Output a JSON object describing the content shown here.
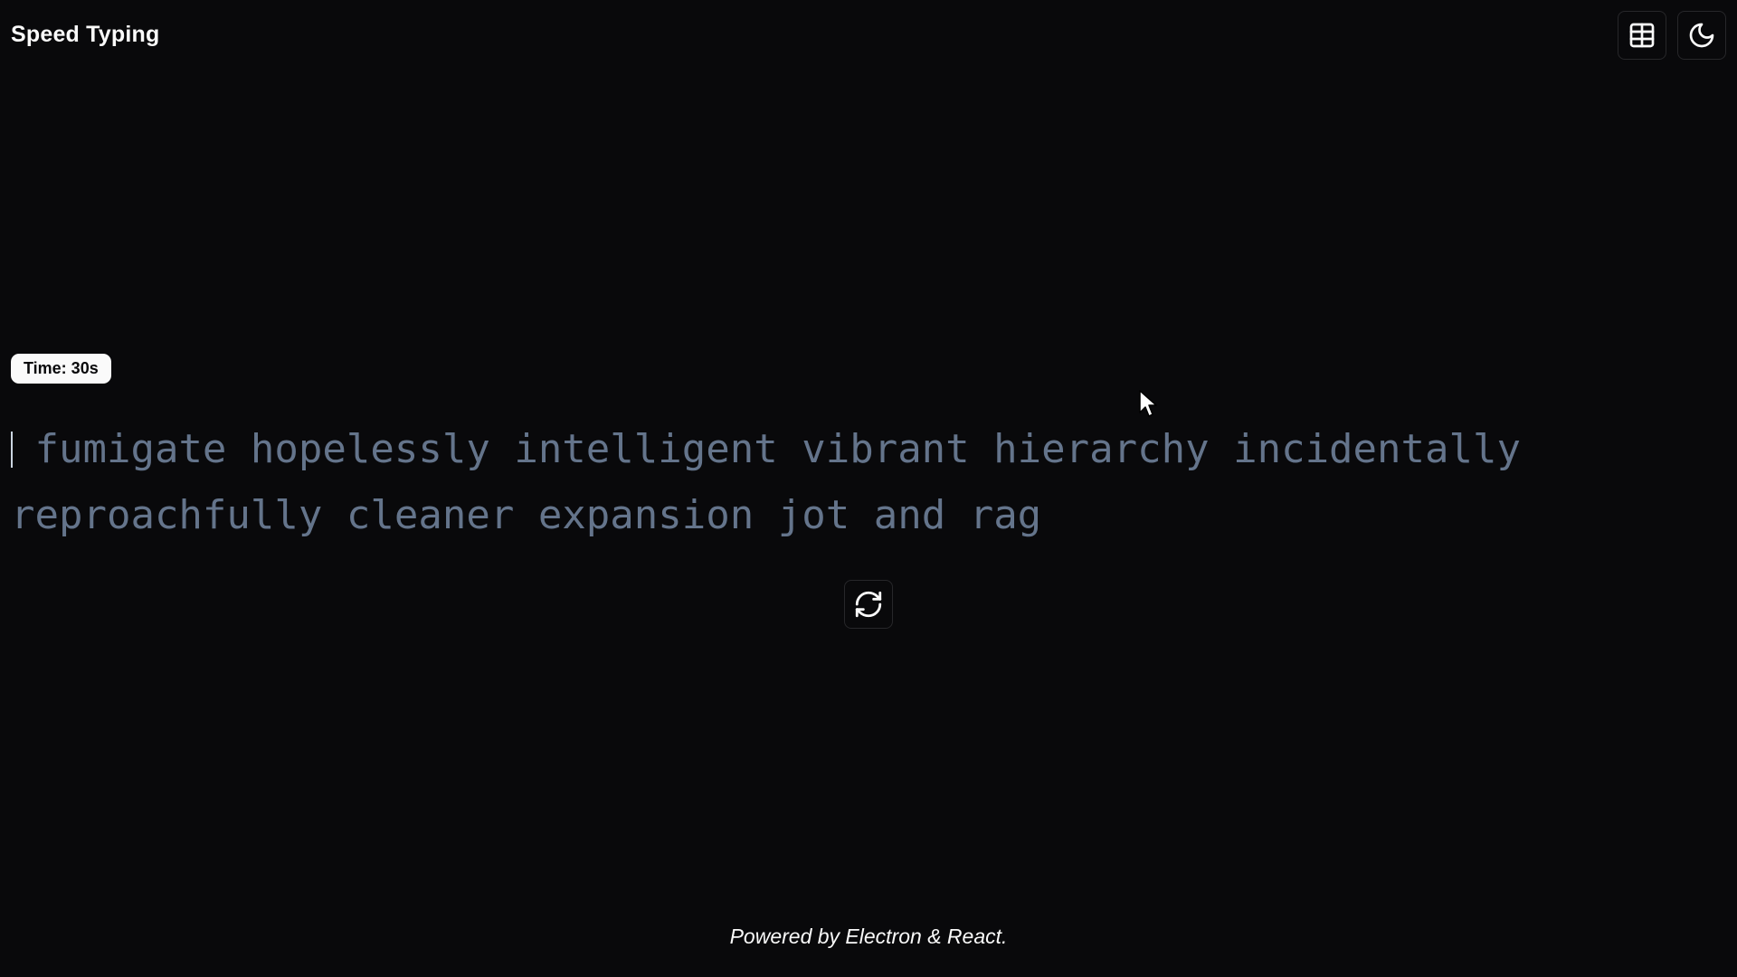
{
  "header": {
    "title": "Speed Typing",
    "table_icon": "table-icon",
    "theme_icon": "moon-icon"
  },
  "timer": {
    "label": "Time: 30s"
  },
  "typing": {
    "words": [
      "fumigate",
      "hopelessly",
      "intelligent",
      "vibrant",
      "hierarchy",
      "incidentally",
      "reproachfully",
      "cleaner",
      "expansion",
      "jot",
      "and",
      "rag"
    ]
  },
  "controls": {
    "restart_icon": "refresh-icon"
  },
  "footer": {
    "text": "Powered by Electron & React."
  },
  "colors": {
    "background": "#09090b",
    "foreground": "#fafafa",
    "untyped_text": "#64748b",
    "border": "#27272a"
  }
}
